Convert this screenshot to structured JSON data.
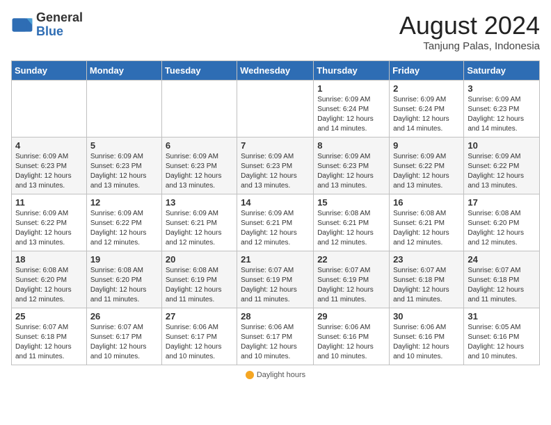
{
  "header": {
    "logo_general": "General",
    "logo_blue": "Blue",
    "month_title": "August 2024",
    "location": "Tanjung Palas, Indonesia"
  },
  "days_of_week": [
    "Sunday",
    "Monday",
    "Tuesday",
    "Wednesday",
    "Thursday",
    "Friday",
    "Saturday"
  ],
  "footer": {
    "label": "Daylight hours"
  },
  "weeks": [
    {
      "days": [
        {
          "num": "",
          "info": ""
        },
        {
          "num": "",
          "info": ""
        },
        {
          "num": "",
          "info": ""
        },
        {
          "num": "",
          "info": ""
        },
        {
          "num": "1",
          "info": "Sunrise: 6:09 AM\nSunset: 6:24 PM\nDaylight: 12 hours\nand 14 minutes."
        },
        {
          "num": "2",
          "info": "Sunrise: 6:09 AM\nSunset: 6:24 PM\nDaylight: 12 hours\nand 14 minutes."
        },
        {
          "num": "3",
          "info": "Sunrise: 6:09 AM\nSunset: 6:23 PM\nDaylight: 12 hours\nand 14 minutes."
        }
      ]
    },
    {
      "days": [
        {
          "num": "4",
          "info": "Sunrise: 6:09 AM\nSunset: 6:23 PM\nDaylight: 12 hours\nand 13 minutes."
        },
        {
          "num": "5",
          "info": "Sunrise: 6:09 AM\nSunset: 6:23 PM\nDaylight: 12 hours\nand 13 minutes."
        },
        {
          "num": "6",
          "info": "Sunrise: 6:09 AM\nSunset: 6:23 PM\nDaylight: 12 hours\nand 13 minutes."
        },
        {
          "num": "7",
          "info": "Sunrise: 6:09 AM\nSunset: 6:23 PM\nDaylight: 12 hours\nand 13 minutes."
        },
        {
          "num": "8",
          "info": "Sunrise: 6:09 AM\nSunset: 6:23 PM\nDaylight: 12 hours\nand 13 minutes."
        },
        {
          "num": "9",
          "info": "Sunrise: 6:09 AM\nSunset: 6:22 PM\nDaylight: 12 hours\nand 13 minutes."
        },
        {
          "num": "10",
          "info": "Sunrise: 6:09 AM\nSunset: 6:22 PM\nDaylight: 12 hours\nand 13 minutes."
        }
      ]
    },
    {
      "days": [
        {
          "num": "11",
          "info": "Sunrise: 6:09 AM\nSunset: 6:22 PM\nDaylight: 12 hours\nand 13 minutes."
        },
        {
          "num": "12",
          "info": "Sunrise: 6:09 AM\nSunset: 6:22 PM\nDaylight: 12 hours\nand 12 minutes."
        },
        {
          "num": "13",
          "info": "Sunrise: 6:09 AM\nSunset: 6:21 PM\nDaylight: 12 hours\nand 12 minutes."
        },
        {
          "num": "14",
          "info": "Sunrise: 6:09 AM\nSunset: 6:21 PM\nDaylight: 12 hours\nand 12 minutes."
        },
        {
          "num": "15",
          "info": "Sunrise: 6:08 AM\nSunset: 6:21 PM\nDaylight: 12 hours\nand 12 minutes."
        },
        {
          "num": "16",
          "info": "Sunrise: 6:08 AM\nSunset: 6:21 PM\nDaylight: 12 hours\nand 12 minutes."
        },
        {
          "num": "17",
          "info": "Sunrise: 6:08 AM\nSunset: 6:20 PM\nDaylight: 12 hours\nand 12 minutes."
        }
      ]
    },
    {
      "days": [
        {
          "num": "18",
          "info": "Sunrise: 6:08 AM\nSunset: 6:20 PM\nDaylight: 12 hours\nand 12 minutes."
        },
        {
          "num": "19",
          "info": "Sunrise: 6:08 AM\nSunset: 6:20 PM\nDaylight: 12 hours\nand 11 minutes."
        },
        {
          "num": "20",
          "info": "Sunrise: 6:08 AM\nSunset: 6:19 PM\nDaylight: 12 hours\nand 11 minutes."
        },
        {
          "num": "21",
          "info": "Sunrise: 6:07 AM\nSunset: 6:19 PM\nDaylight: 12 hours\nand 11 minutes."
        },
        {
          "num": "22",
          "info": "Sunrise: 6:07 AM\nSunset: 6:19 PM\nDaylight: 12 hours\nand 11 minutes."
        },
        {
          "num": "23",
          "info": "Sunrise: 6:07 AM\nSunset: 6:18 PM\nDaylight: 12 hours\nand 11 minutes."
        },
        {
          "num": "24",
          "info": "Sunrise: 6:07 AM\nSunset: 6:18 PM\nDaylight: 12 hours\nand 11 minutes."
        }
      ]
    },
    {
      "days": [
        {
          "num": "25",
          "info": "Sunrise: 6:07 AM\nSunset: 6:18 PM\nDaylight: 12 hours\nand 11 minutes."
        },
        {
          "num": "26",
          "info": "Sunrise: 6:07 AM\nSunset: 6:17 PM\nDaylight: 12 hours\nand 10 minutes."
        },
        {
          "num": "27",
          "info": "Sunrise: 6:06 AM\nSunset: 6:17 PM\nDaylight: 12 hours\nand 10 minutes."
        },
        {
          "num": "28",
          "info": "Sunrise: 6:06 AM\nSunset: 6:17 PM\nDaylight: 12 hours\nand 10 minutes."
        },
        {
          "num": "29",
          "info": "Sunrise: 6:06 AM\nSunset: 6:16 PM\nDaylight: 12 hours\nand 10 minutes."
        },
        {
          "num": "30",
          "info": "Sunrise: 6:06 AM\nSunset: 6:16 PM\nDaylight: 12 hours\nand 10 minutes."
        },
        {
          "num": "31",
          "info": "Sunrise: 6:05 AM\nSunset: 6:16 PM\nDaylight: 12 hours\nand 10 minutes."
        }
      ]
    }
  ]
}
